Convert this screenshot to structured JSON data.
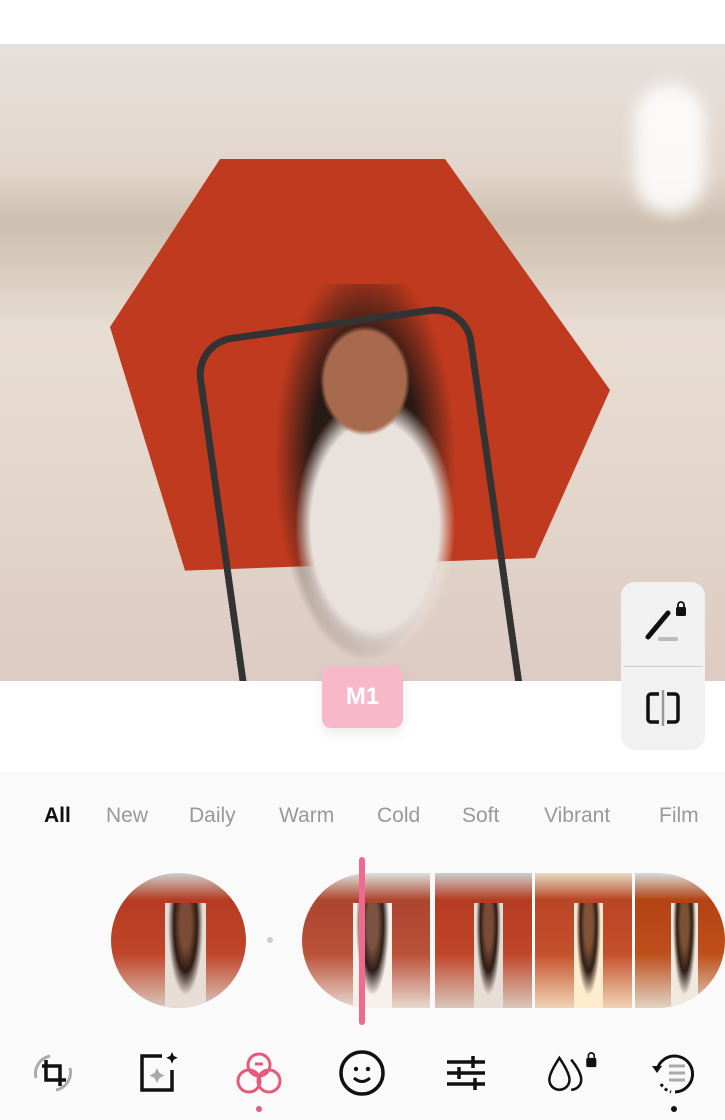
{
  "preview": {
    "preset_badge": "M1"
  },
  "side_tools": [
    {
      "icon": "magic-brush-icon",
      "locked": true
    },
    {
      "icon": "compare-icon"
    }
  ],
  "categories": [
    {
      "label": "All",
      "active": true
    },
    {
      "label": "New"
    },
    {
      "label": "Daily"
    },
    {
      "label": "Warm"
    },
    {
      "label": "Cold"
    },
    {
      "label": "Soft"
    },
    {
      "label": "Vibrant"
    },
    {
      "label": "Film"
    }
  ],
  "accent_color": "#f06a8f",
  "toolbar": [
    {
      "icon": "crop-rotate-icon"
    },
    {
      "icon": "ai-enhance-icon"
    },
    {
      "icon": "filters-icon",
      "active": true
    },
    {
      "icon": "face-retouch-icon"
    },
    {
      "icon": "adjust-sliders-icon"
    },
    {
      "icon": "effects-drops-icon",
      "locked": true
    },
    {
      "icon": "history-icon"
    }
  ]
}
